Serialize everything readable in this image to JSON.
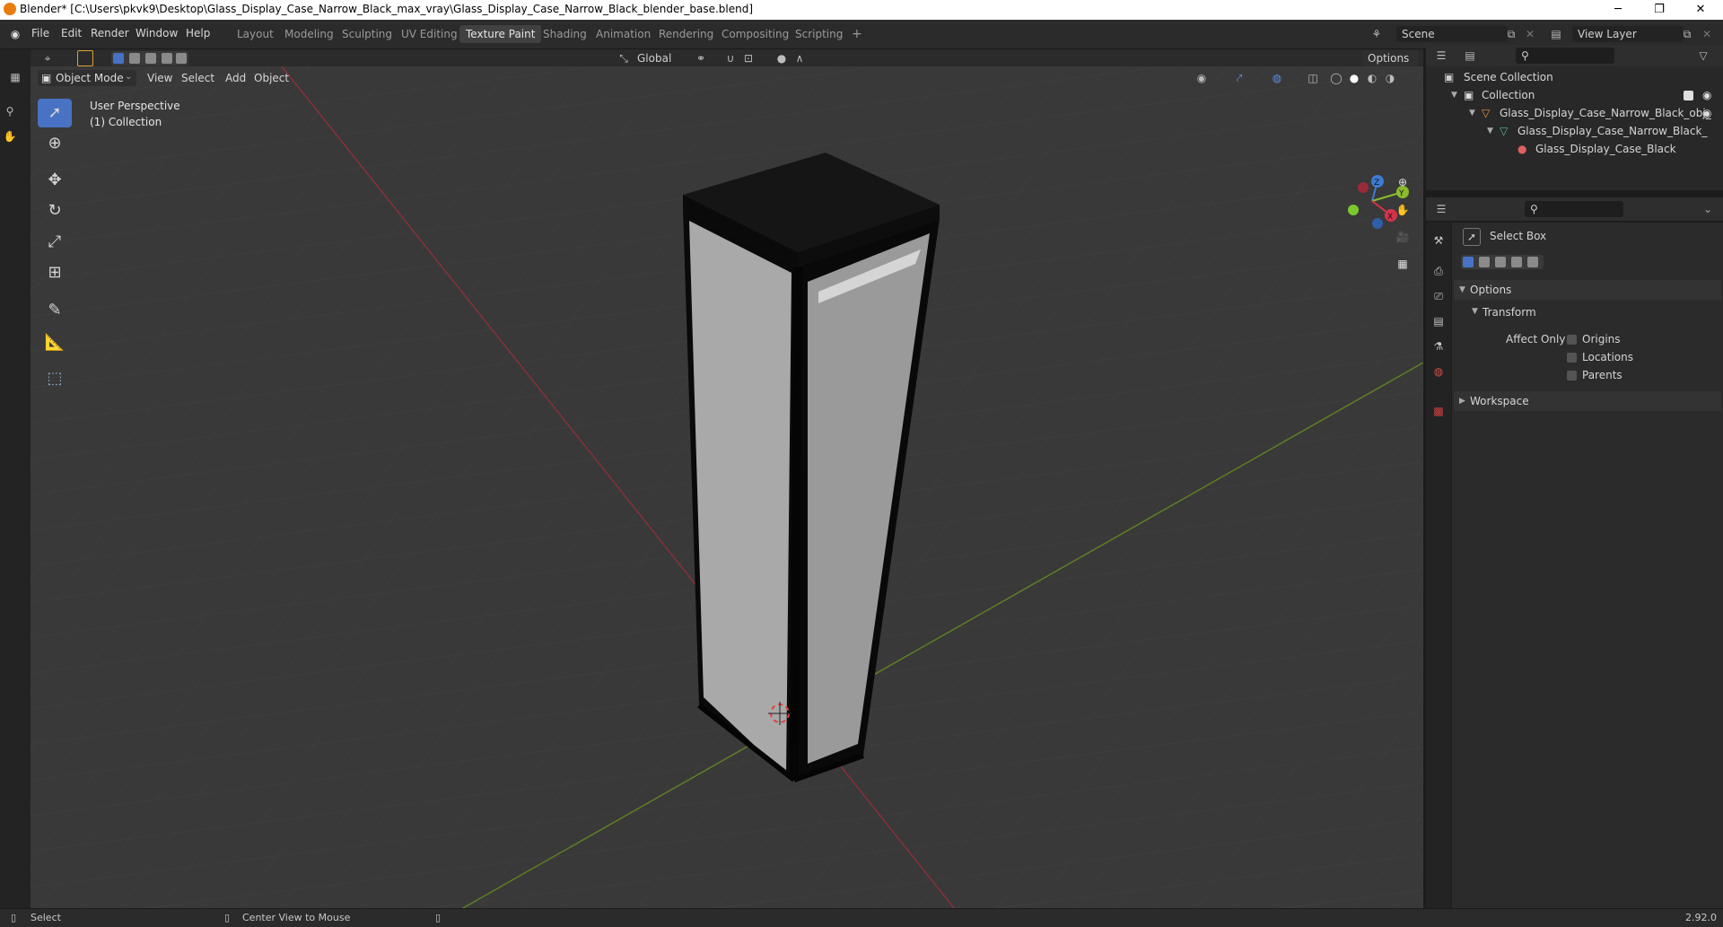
{
  "window": {
    "title": "Blender* [C:\\Users\\pkvk9\\Desktop\\Glass_Display_Case_Narrow_Black_max_vray\\Glass_Display_Case_Narrow_Black_blender_base.blend]",
    "minimize": "─",
    "restore": "❐",
    "close": "✕"
  },
  "menubar": {
    "items": [
      "File",
      "Edit",
      "Render",
      "Window",
      "Help"
    ]
  },
  "workspaces": {
    "tabs": [
      "Layout",
      "Modeling",
      "Sculpting",
      "UV Editing",
      "Texture Paint",
      "Shading",
      "Animation",
      "Rendering",
      "Compositing",
      "Scripting"
    ],
    "active": "Texture Paint",
    "add": "+"
  },
  "scene": {
    "name": "Scene"
  },
  "view_layer": {
    "name": "View Layer"
  },
  "viewport_header": {
    "mode": "Object Mode",
    "menus": [
      "View",
      "Select",
      "Add",
      "Object"
    ],
    "orientation": "Global",
    "options": "Options"
  },
  "viewport": {
    "perspective": "User Perspective",
    "collection": "(1) Collection",
    "gizmo_axes": {
      "x": "X",
      "y": "Y",
      "z": "Z"
    }
  },
  "outliner": {
    "root": "Scene Collection",
    "items": [
      {
        "label": "Collection",
        "indent": 1
      },
      {
        "label": "Glass_Display_Case_Narrow_Black_obj_",
        "indent": 2
      },
      {
        "label": "Glass_Display_Case_Narrow_Black_",
        "indent": 3
      },
      {
        "label": "Glass_Display_Case_Black",
        "indent": 4
      }
    ]
  },
  "properties": {
    "tool_name": "Select Box",
    "options_label": "Options",
    "transform_label": "Transform",
    "affect_only_label": "Affect Only",
    "checkboxes": [
      "Origins",
      "Locations",
      "Parents"
    ],
    "workspace_label": "Workspace"
  },
  "statusbar": {
    "select": "Select",
    "center_view": "Center View to Mouse",
    "version": "2.92.0"
  },
  "colors": {
    "accent": "#4872c4",
    "axis_x": "#d6344a",
    "axis_y": "#8bbd2a",
    "axis_z": "#3d7cd6"
  }
}
